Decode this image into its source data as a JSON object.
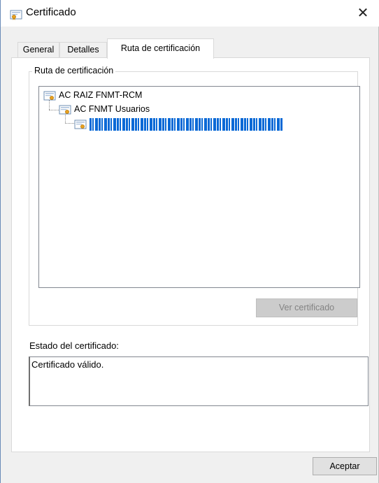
{
  "window": {
    "title": "Certificado",
    "close_glyph": "✕"
  },
  "tabs": [
    {
      "label": "General"
    },
    {
      "label": "Detalles"
    },
    {
      "label": "Ruta de certificación"
    }
  ],
  "path_group": {
    "label": "Ruta de certificación",
    "nodes": [
      {
        "label": "AC RAIZ FNMT-RCM",
        "icon": "certificate-icon"
      },
      {
        "label": "AC FNMT Usuarios",
        "icon": "certificate-icon"
      },
      {
        "label": "",
        "icon": "certificate-icon",
        "selected": true
      }
    ],
    "view_button": "Ver certificado"
  },
  "status": {
    "label": "Estado del certificado:",
    "value": "Certificado válido."
  },
  "footer": {
    "accept_button": "Aceptar"
  },
  "colors": {
    "selection": "#0a69d6",
    "accent_border": "#6a8bb8"
  }
}
